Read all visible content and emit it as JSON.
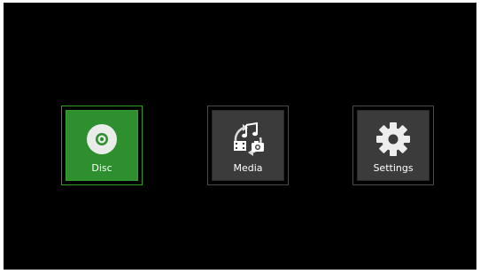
{
  "menu": {
    "items": [
      {
        "label": "Disc",
        "icon": "disc-icon",
        "selected": true
      },
      {
        "label": "Media",
        "icon": "media-icon",
        "selected": false
      },
      {
        "label": "Settings",
        "icon": "gear-icon",
        "selected": false
      }
    ]
  },
  "colors": {
    "background": "#000000",
    "selected_tile": "#2d8f2d",
    "tile": "#3b3b3b",
    "label": "#ffffff"
  }
}
